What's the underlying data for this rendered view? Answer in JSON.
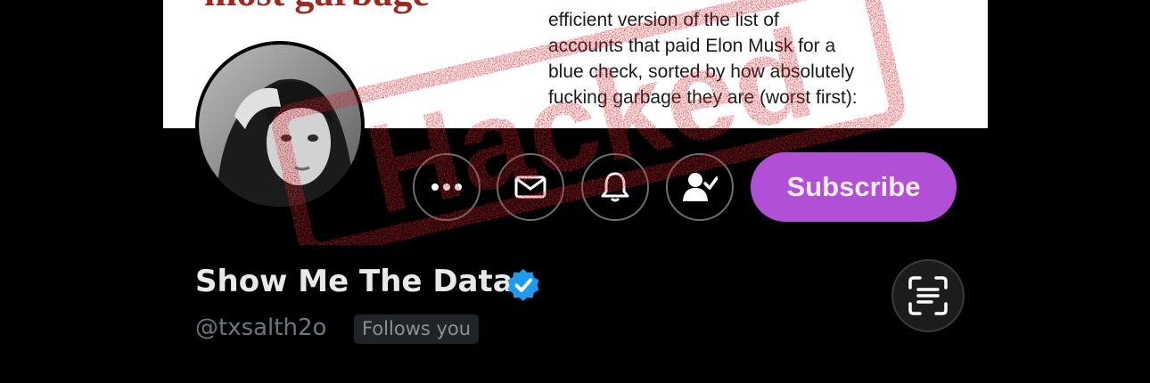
{
  "banner": {
    "heading": "most garbage",
    "lines": [
      "efficient version of the list of",
      "accounts that paid Elon Musk for a",
      "blue check, sorted by how absolutely",
      "fucking garbage they are (worst first):"
    ]
  },
  "profile": {
    "display_name": "Show Me The Data",
    "handle": "@txsalth2o",
    "follows_you": "Follows you",
    "verified": true
  },
  "actions": {
    "subscribe_label": "Subscribe",
    "more": "more-icon",
    "message": "message-icon",
    "notifications": "bell-icon",
    "following": "following-check-icon"
  },
  "overlay": {
    "stamp_text": "Hacked",
    "stamp_color": "#d8212a"
  },
  "colors": {
    "subscribe": "#b14fd6",
    "verified": "#1d9bf0",
    "background": "#000000"
  }
}
